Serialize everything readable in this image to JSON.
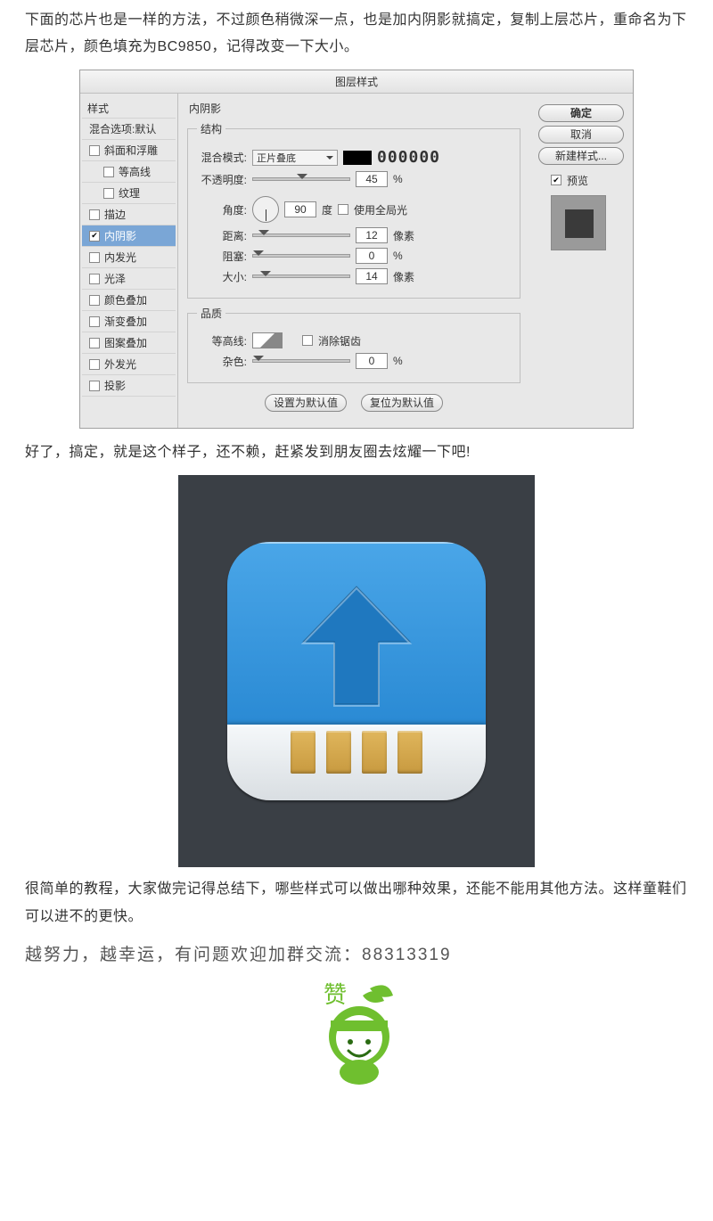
{
  "paragraphs": {
    "p1": "下面的芯片也是一样的方法，不过颜色稍微深一点，也是加内阴影就搞定，复制上层芯片，重命名为下层芯片，颜色填充为BC9850，记得改变一下大小。",
    "p2": "好了，搞定，就是这个样子，还不赖，赶紧发到朋友圈去炫耀一下吧!",
    "p3": "很简单的教程，大家做完记得总结下，哪些样式可以做出哪种效果，还能不能用其他方法。这样童鞋们可以进不的更快。",
    "p4": "越努力，越幸运，有问题欢迎加群交流：88313319"
  },
  "dialog": {
    "title": "图层样式",
    "left": {
      "header": "样式",
      "blend_options": "混合选项:默认",
      "items": {
        "bevel": "斜面和浮雕",
        "contour": "等高线",
        "texture": "纹理",
        "stroke": "描边",
        "inner_shadow": "内阴影",
        "inner_glow": "内发光",
        "satin": "光泽",
        "color_overlay": "颜色叠加",
        "gradient_overlay": "渐变叠加",
        "pattern_overlay": "图案叠加",
        "outer_glow": "外发光",
        "drop_shadow": "投影"
      }
    },
    "mid": {
      "title": "内阴影",
      "group_structure": "结构",
      "blend_mode_label": "混合模式:",
      "blend_mode_value": "正片叠底",
      "color_hex": "000000",
      "opacity_label": "不透明度:",
      "opacity_value": "45",
      "percent": "%",
      "angle_label": "角度:",
      "angle_value": "90",
      "angle_unit": "度",
      "global_light": "使用全局光",
      "distance_label": "距离:",
      "distance_value": "12",
      "px": "像素",
      "choke_label": "阻塞:",
      "choke_value": "0",
      "size_label": "大小:",
      "size_value": "14",
      "group_quality": "品质",
      "contour_label": "等高线:",
      "antialias": "消除锯齿",
      "noise_label": "杂色:",
      "noise_value": "0",
      "btn_default": "设置为默认值",
      "btn_reset": "复位为默认值"
    },
    "right": {
      "ok": "确定",
      "cancel": "取消",
      "new_style": "新建样式...",
      "preview": "预览"
    }
  },
  "mascot": {
    "label": "赞"
  }
}
